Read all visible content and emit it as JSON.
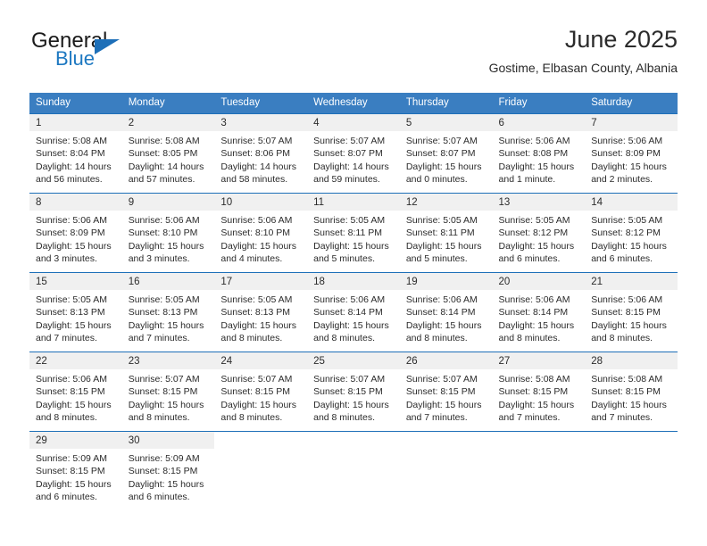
{
  "brand": {
    "word1": "General",
    "word2": "Blue",
    "triangle_color": "#1d6fb8",
    "blue_color": "#1d78c1"
  },
  "header": {
    "title": "June 2025",
    "subtitle": "Gostime, Elbasan County, Albania"
  },
  "theme": {
    "header_bg": "#3a7ec1",
    "row_rule": "#1d6fb8",
    "daynum_bg": "#f0f0f0",
    "text": "#2b2b2b"
  },
  "weekday_headers": [
    "Sunday",
    "Monday",
    "Tuesday",
    "Wednesday",
    "Thursday",
    "Friday",
    "Saturday"
  ],
  "weeks": [
    [
      {
        "day": "1",
        "sunrise": "Sunrise: 5:08 AM",
        "sunset": "Sunset: 8:04 PM",
        "daylight": "Daylight: 14 hours and 56 minutes."
      },
      {
        "day": "2",
        "sunrise": "Sunrise: 5:08 AM",
        "sunset": "Sunset: 8:05 PM",
        "daylight": "Daylight: 14 hours and 57 minutes."
      },
      {
        "day": "3",
        "sunrise": "Sunrise: 5:07 AM",
        "sunset": "Sunset: 8:06 PM",
        "daylight": "Daylight: 14 hours and 58 minutes."
      },
      {
        "day": "4",
        "sunrise": "Sunrise: 5:07 AM",
        "sunset": "Sunset: 8:07 PM",
        "daylight": "Daylight: 14 hours and 59 minutes."
      },
      {
        "day": "5",
        "sunrise": "Sunrise: 5:07 AM",
        "sunset": "Sunset: 8:07 PM",
        "daylight": "Daylight: 15 hours and 0 minutes."
      },
      {
        "day": "6",
        "sunrise": "Sunrise: 5:06 AM",
        "sunset": "Sunset: 8:08 PM",
        "daylight": "Daylight: 15 hours and 1 minute."
      },
      {
        "day": "7",
        "sunrise": "Sunrise: 5:06 AM",
        "sunset": "Sunset: 8:09 PM",
        "daylight": "Daylight: 15 hours and 2 minutes."
      }
    ],
    [
      {
        "day": "8",
        "sunrise": "Sunrise: 5:06 AM",
        "sunset": "Sunset: 8:09 PM",
        "daylight": "Daylight: 15 hours and 3 minutes."
      },
      {
        "day": "9",
        "sunrise": "Sunrise: 5:06 AM",
        "sunset": "Sunset: 8:10 PM",
        "daylight": "Daylight: 15 hours and 3 minutes."
      },
      {
        "day": "10",
        "sunrise": "Sunrise: 5:06 AM",
        "sunset": "Sunset: 8:10 PM",
        "daylight": "Daylight: 15 hours and 4 minutes."
      },
      {
        "day": "11",
        "sunrise": "Sunrise: 5:05 AM",
        "sunset": "Sunset: 8:11 PM",
        "daylight": "Daylight: 15 hours and 5 minutes."
      },
      {
        "day": "12",
        "sunrise": "Sunrise: 5:05 AM",
        "sunset": "Sunset: 8:11 PM",
        "daylight": "Daylight: 15 hours and 5 minutes."
      },
      {
        "day": "13",
        "sunrise": "Sunrise: 5:05 AM",
        "sunset": "Sunset: 8:12 PM",
        "daylight": "Daylight: 15 hours and 6 minutes."
      },
      {
        "day": "14",
        "sunrise": "Sunrise: 5:05 AM",
        "sunset": "Sunset: 8:12 PM",
        "daylight": "Daylight: 15 hours and 6 minutes."
      }
    ],
    [
      {
        "day": "15",
        "sunrise": "Sunrise: 5:05 AM",
        "sunset": "Sunset: 8:13 PM",
        "daylight": "Daylight: 15 hours and 7 minutes."
      },
      {
        "day": "16",
        "sunrise": "Sunrise: 5:05 AM",
        "sunset": "Sunset: 8:13 PM",
        "daylight": "Daylight: 15 hours and 7 minutes."
      },
      {
        "day": "17",
        "sunrise": "Sunrise: 5:05 AM",
        "sunset": "Sunset: 8:13 PM",
        "daylight": "Daylight: 15 hours and 8 minutes."
      },
      {
        "day": "18",
        "sunrise": "Sunrise: 5:06 AM",
        "sunset": "Sunset: 8:14 PM",
        "daylight": "Daylight: 15 hours and 8 minutes."
      },
      {
        "day": "19",
        "sunrise": "Sunrise: 5:06 AM",
        "sunset": "Sunset: 8:14 PM",
        "daylight": "Daylight: 15 hours and 8 minutes."
      },
      {
        "day": "20",
        "sunrise": "Sunrise: 5:06 AM",
        "sunset": "Sunset: 8:14 PM",
        "daylight": "Daylight: 15 hours and 8 minutes."
      },
      {
        "day": "21",
        "sunrise": "Sunrise: 5:06 AM",
        "sunset": "Sunset: 8:15 PM",
        "daylight": "Daylight: 15 hours and 8 minutes."
      }
    ],
    [
      {
        "day": "22",
        "sunrise": "Sunrise: 5:06 AM",
        "sunset": "Sunset: 8:15 PM",
        "daylight": "Daylight: 15 hours and 8 minutes."
      },
      {
        "day": "23",
        "sunrise": "Sunrise: 5:07 AM",
        "sunset": "Sunset: 8:15 PM",
        "daylight": "Daylight: 15 hours and 8 minutes."
      },
      {
        "day": "24",
        "sunrise": "Sunrise: 5:07 AM",
        "sunset": "Sunset: 8:15 PM",
        "daylight": "Daylight: 15 hours and 8 minutes."
      },
      {
        "day": "25",
        "sunrise": "Sunrise: 5:07 AM",
        "sunset": "Sunset: 8:15 PM",
        "daylight": "Daylight: 15 hours and 8 minutes."
      },
      {
        "day": "26",
        "sunrise": "Sunrise: 5:07 AM",
        "sunset": "Sunset: 8:15 PM",
        "daylight": "Daylight: 15 hours and 7 minutes."
      },
      {
        "day": "27",
        "sunrise": "Sunrise: 5:08 AM",
        "sunset": "Sunset: 8:15 PM",
        "daylight": "Daylight: 15 hours and 7 minutes."
      },
      {
        "day": "28",
        "sunrise": "Sunrise: 5:08 AM",
        "sunset": "Sunset: 8:15 PM",
        "daylight": "Daylight: 15 hours and 7 minutes."
      }
    ],
    [
      {
        "day": "29",
        "sunrise": "Sunrise: 5:09 AM",
        "sunset": "Sunset: 8:15 PM",
        "daylight": "Daylight: 15 hours and 6 minutes."
      },
      {
        "day": "30",
        "sunrise": "Sunrise: 5:09 AM",
        "sunset": "Sunset: 8:15 PM",
        "daylight": "Daylight: 15 hours and 6 minutes."
      },
      null,
      null,
      null,
      null,
      null
    ]
  ]
}
